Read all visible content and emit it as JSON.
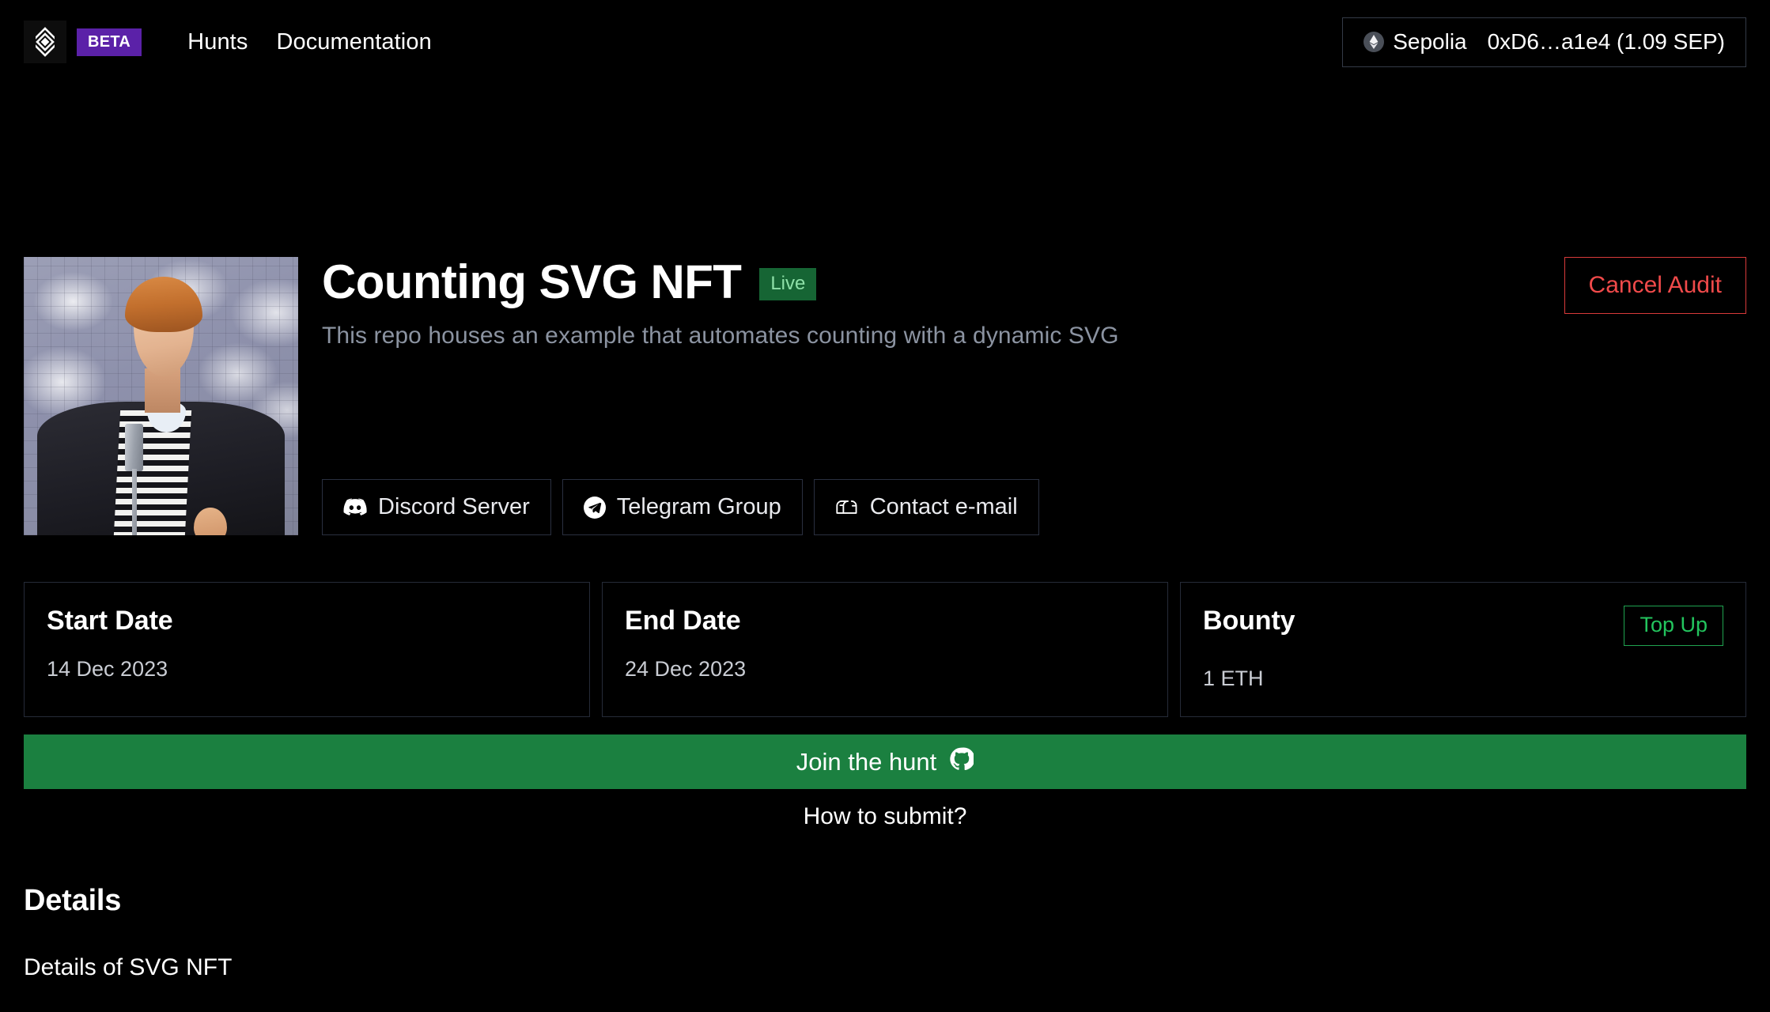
{
  "navbar": {
    "logo_icon": "diamond-logo-icon",
    "beta_label": "BETA",
    "links": [
      {
        "label": "Hunts",
        "name": "nav-link-hunts"
      },
      {
        "label": "Documentation",
        "name": "nav-link-documentation"
      }
    ],
    "wallet": {
      "chain_icon": "ethereum-icon",
      "network": "Sepolia",
      "address_balance": "0xD6…a1e4 (1.09 SEP)"
    }
  },
  "hero": {
    "thumbnail_alt": "hunt-thumbnail",
    "title": "Counting SVG NFT",
    "status_badge": "Live",
    "subtitle": "This repo houses an example that automates counting with a dynamic SVG",
    "cancel_button": "Cancel Audit",
    "social_links": [
      {
        "label": "Discord Server",
        "icon": "discord-icon",
        "name": "discord-server-button"
      },
      {
        "label": "Telegram Group",
        "icon": "telegram-icon",
        "name": "telegram-group-button"
      },
      {
        "label": "Contact e-mail",
        "icon": "mailbox-icon",
        "name": "contact-email-button"
      }
    ]
  },
  "stats": [
    {
      "label": "Start Date",
      "value": "14 Dec 2023"
    },
    {
      "label": "End Date",
      "value": "24 Dec 2023"
    },
    {
      "label": "Bounty",
      "value": "1 ETH",
      "action_label": "Top Up"
    }
  ],
  "join": {
    "button_label": "Join the hunt",
    "button_icon": "github-icon",
    "help_link": "How to submit?"
  },
  "details": {
    "heading": "Details",
    "body": "Details of SVG NFT"
  },
  "colors": {
    "page_background": "#000000",
    "beta_purple": "#5b21a8",
    "live_green_bg": "#166534",
    "live_green_text": "#8ee0a8",
    "join_green": "#1b8040",
    "topup_green": "#23c55e",
    "cancel_red": "#f04a4a",
    "muted_text": "#8b93a1",
    "card_border": "#262b38"
  }
}
